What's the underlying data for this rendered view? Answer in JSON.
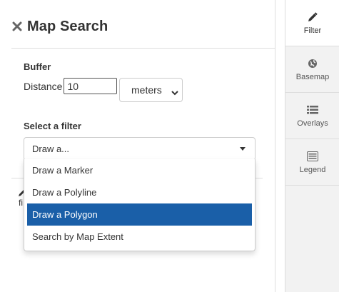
{
  "panel": {
    "title": "Map Search",
    "buffer": {
      "heading": "Buffer",
      "distance_label": "Distance",
      "distance_value": "10",
      "unit_selected": "meters"
    },
    "filter": {
      "heading": "Select a filter",
      "selected_text": "Draw a...",
      "options": [
        "Draw a Marker",
        "Draw a Polyline",
        "Draw a Polygon",
        "Search by Map Extent"
      ],
      "highlighted_option": "Draw a Polygon"
    },
    "hidden_fragment": "fi"
  },
  "sidebar": {
    "tabs": [
      {
        "label": "Filter",
        "icon": "pencil-icon",
        "active": true
      },
      {
        "label": "Basemap",
        "icon": "globe-icon",
        "active": false
      },
      {
        "label": "Overlays",
        "icon": "list-icon",
        "active": false
      },
      {
        "label": "Legend",
        "icon": "legend-icon",
        "active": false
      }
    ]
  },
  "colors": {
    "accent": "#1a5fa8",
    "sidebar_bg": "#f2f2f2",
    "border": "#dddddd"
  }
}
